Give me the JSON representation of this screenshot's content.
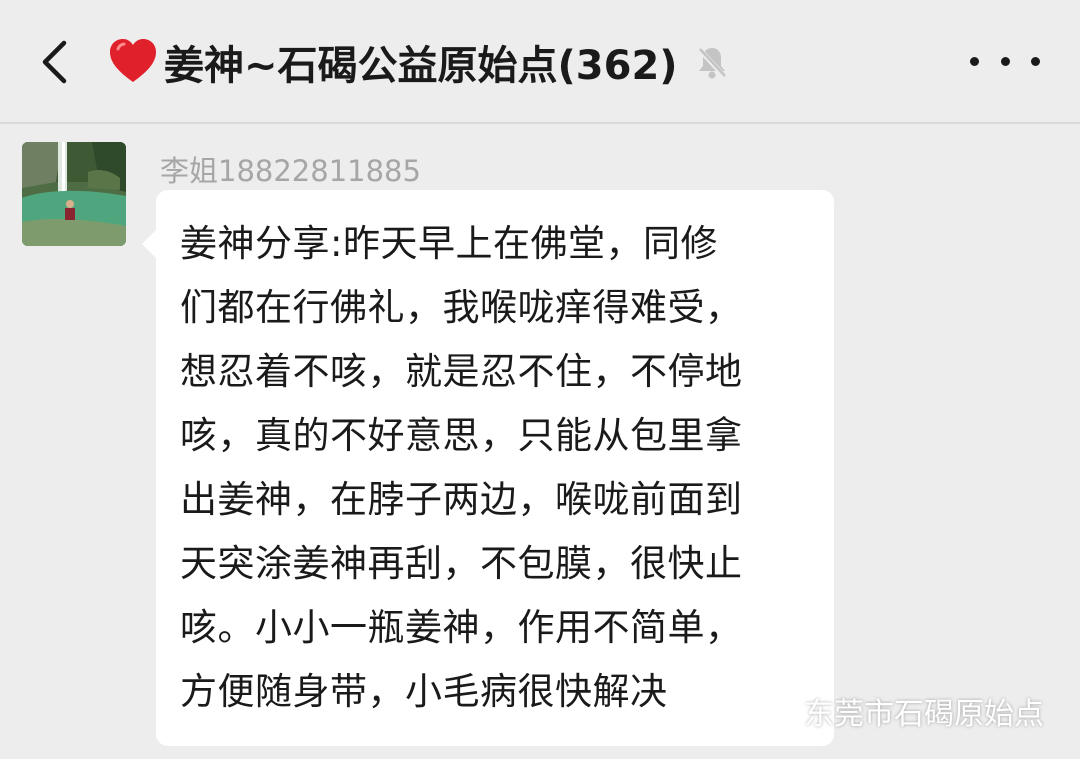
{
  "header": {
    "title": "姜神~石碣公益原始点(362)",
    "back_icon": "chevron-left-icon",
    "heart_icon": "red-heart-emoji",
    "mute_icon": "bell-muted-icon",
    "more_icon": "more-dots-icon"
  },
  "message": {
    "sender": "李姐18822811885",
    "lines": [
      "姜神分享:昨天早上在佛堂，同修",
      "们都在行佛礼，我喉咙痒得难受，",
      "想忍着不咳，就是忍不住，不停地",
      "咳，真的不好意思，只能从包里拿",
      "出姜神，在脖子两边，喉咙前面到",
      "天突涂姜神再刮，不包膜，很快止",
      "咳。小小一瓶姜神，作用不简单，",
      "方便随身带，小毛病很快解决"
    ]
  },
  "watermark": {
    "text": "东莞市石碣原始点",
    "icon": "wechat-logo"
  },
  "colors": {
    "background": "#ededed",
    "bubble": "#ffffff",
    "sender_text": "#a6a6a6",
    "heart": "#e0202a"
  }
}
